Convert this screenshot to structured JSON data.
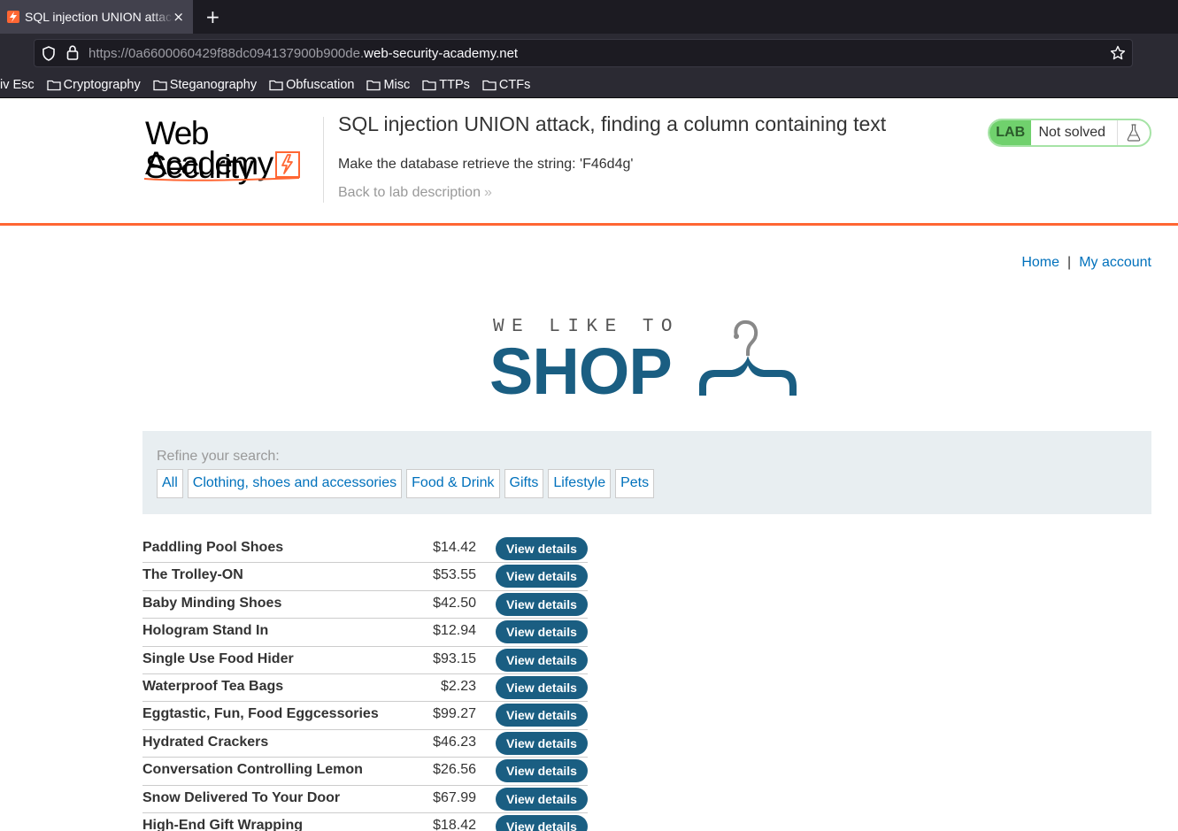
{
  "browser": {
    "tab_title": "SQL injection UNION attack, finding a column containing text",
    "tab_close": "×",
    "new_tab": "+",
    "url_prefix": "https://0a6600060429f88dc094137900b900de.",
    "url_host": "web-security-academy.net"
  },
  "bookmarks": [
    {
      "label": "iv Esc"
    },
    {
      "label": "Cryptography"
    },
    {
      "label": "Steganography"
    },
    {
      "label": "Obfuscation"
    },
    {
      "label": "Misc"
    },
    {
      "label": "TTPs"
    },
    {
      "label": "CTFs"
    }
  ],
  "lab": {
    "logo_line1": "Web Security",
    "logo_line2": "Academy",
    "title": "SQL injection UNION attack, finding a column containing text",
    "goal": "Make the database retrieve the string: 'F46d4g'",
    "back_link": "Back to lab description",
    "back_chevron": "»",
    "badge": "LAB",
    "status": "Not solved",
    "accent": "#ff6633",
    "status_color": "#70d16d"
  },
  "nav": {
    "home": "Home",
    "separator": "|",
    "account": "My account",
    "link_color": "#0071bc"
  },
  "shop_logo": {
    "tagline": "WE LIKE TO",
    "word": "SHOP",
    "color": "#1a5e82"
  },
  "refine": {
    "label": "Refine your search:",
    "filters": [
      "All",
      "Clothing, shoes and accessories",
      "Food & Drink",
      "Gifts",
      "Lifestyle",
      "Pets"
    ]
  },
  "products": [
    {
      "name": "Paddling Pool Shoes",
      "price": "$14.42",
      "button": "View details"
    },
    {
      "name": "The Trolley-ON",
      "price": "$53.55",
      "button": "View details"
    },
    {
      "name": "Baby Minding Shoes",
      "price": "$42.50",
      "button": "View details"
    },
    {
      "name": "Hologram Stand In",
      "price": "$12.94",
      "button": "View details"
    },
    {
      "name": "Single Use Food Hider",
      "price": "$93.15",
      "button": "View details"
    },
    {
      "name": "Waterproof Tea Bags",
      "price": "$2.23",
      "button": "View details"
    },
    {
      "name": "Eggtastic, Fun, Food Eggcessories",
      "price": "$99.27",
      "button": "View details"
    },
    {
      "name": "Hydrated Crackers",
      "price": "$46.23",
      "button": "View details"
    },
    {
      "name": "Conversation Controlling Lemon",
      "price": "$26.56",
      "button": "View details"
    },
    {
      "name": "Snow Delivered To Your Door",
      "price": "$67.99",
      "button": "View details"
    },
    {
      "name": "High-End Gift Wrapping",
      "price": "$18.42",
      "button": "View details"
    }
  ]
}
